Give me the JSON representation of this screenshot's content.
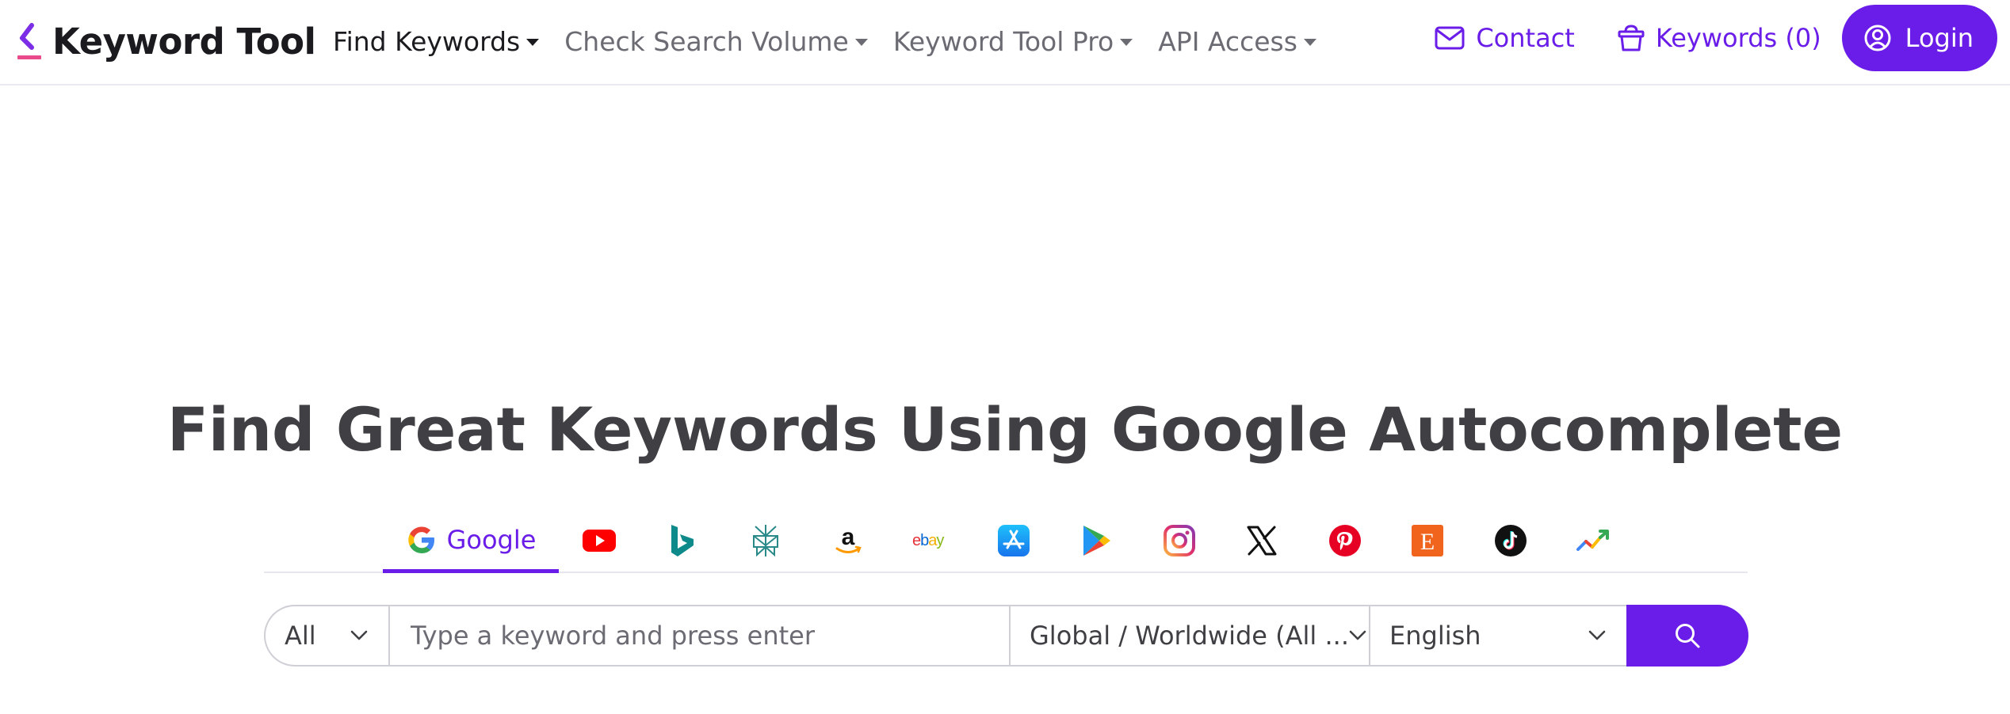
{
  "brand": {
    "name": "Keyword Tool",
    "accent_color": "#6a1ce8",
    "mark_colors": [
      "#7b2ee6",
      "#e84a8a"
    ]
  },
  "nav": {
    "items": [
      {
        "label": "Find Keywords",
        "active": true
      },
      {
        "label": "Check Search Volume",
        "active": false
      },
      {
        "label": "Keyword Tool Pro",
        "active": false
      },
      {
        "label": "API Access",
        "active": false
      }
    ],
    "contact_label": "Contact",
    "keywords_label": "Keywords (0)",
    "login_label": "Login"
  },
  "hero": {
    "title": "Find Great Keywords Using Google Autocomplete"
  },
  "engines": {
    "active": "Google",
    "items": [
      {
        "name": "Google",
        "icon": "google-icon"
      },
      {
        "name": "YouTube",
        "icon": "youtube-icon"
      },
      {
        "name": "Bing",
        "icon": "bing-icon"
      },
      {
        "name": "Perplexity",
        "icon": "perplexity-icon"
      },
      {
        "name": "Amazon",
        "icon": "amazon-icon"
      },
      {
        "name": "eBay",
        "icon": "ebay-icon"
      },
      {
        "name": "App Store",
        "icon": "app-store-icon"
      },
      {
        "name": "Play Store",
        "icon": "play-store-icon"
      },
      {
        "name": "Instagram",
        "icon": "instagram-icon"
      },
      {
        "name": "X",
        "icon": "x-icon"
      },
      {
        "name": "Pinterest",
        "icon": "pinterest-icon"
      },
      {
        "name": "Etsy",
        "icon": "etsy-icon"
      },
      {
        "name": "TikTok",
        "icon": "tiktok-icon"
      },
      {
        "name": "Google Trends",
        "icon": "trends-icon"
      }
    ],
    "ebay_text": "ebay",
    "etsy_text": "E"
  },
  "search": {
    "scope_value": "All",
    "placeholder": "Type a keyword and press enter",
    "location_value": "Global / Worldwide (All ...",
    "language_value": "English"
  }
}
